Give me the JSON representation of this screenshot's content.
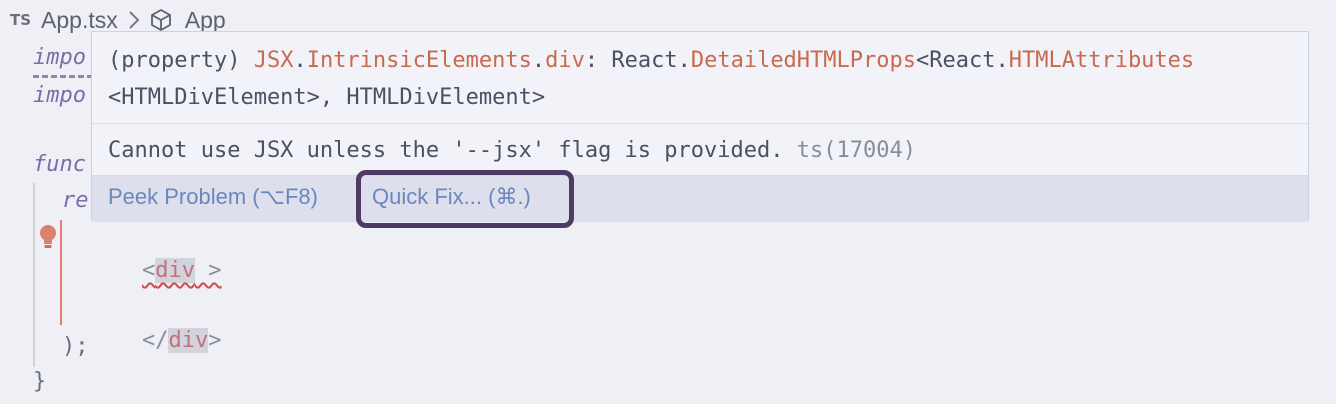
{
  "breadcrumb": {
    "badge": "TS",
    "file": "App.tsx",
    "symbol": "App"
  },
  "code": {
    "line_import1": "impo",
    "line_import2": "impo",
    "line_func": "func",
    "line_return": "re",
    "div_open_lt": "<",
    "div_open_name": "div",
    "div_open_gt": " >",
    "div_close_lt": "</",
    "div_close_name": "div",
    "div_close_gt": ">",
    "paren_close": ");",
    "brace_close": "}"
  },
  "hover": {
    "sig_prefix": "(property) ",
    "sig_jsx": "JSX",
    "sig_dot1": ".",
    "sig_intrinsic": "IntrinsicElements",
    "sig_dot2": ".",
    "sig_div": "div",
    "sig_colon": ": React.",
    "sig_detailed": "DetailedHTMLProps",
    "sig_lt": "<React.",
    "sig_htmlattrs": "HTMLAttributes",
    "sig_line2": "<HTMLDivElement>, HTMLDivElement>",
    "diagnostic": "Cannot use JSX unless the '--jsx' flag is provided.",
    "diagnostic_code": "ts(17004)",
    "peek_label": "Peek Problem (⌥F8)",
    "quickfix_label": "Quick Fix... (⌘.)"
  },
  "colors": {
    "accent": "#c9694f",
    "link": "#6c86bf",
    "error": "#d4484a",
    "annotation_ring": "#4e3a62"
  },
  "icons": [
    "chevron-right-icon",
    "cube-icon",
    "lightbulb-icon"
  ]
}
